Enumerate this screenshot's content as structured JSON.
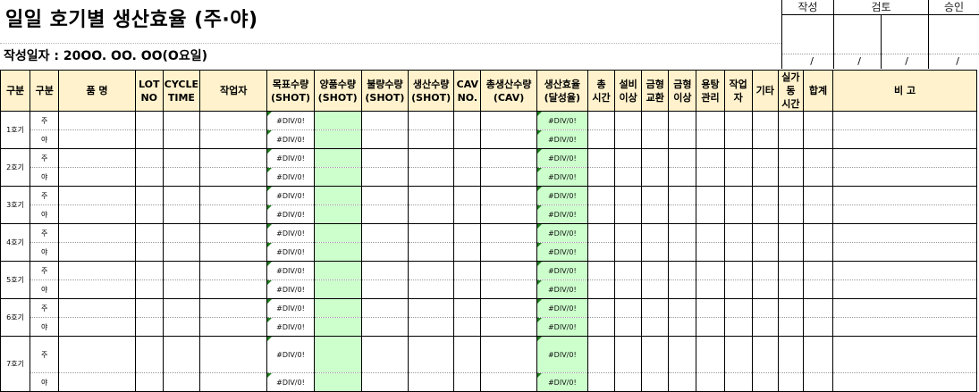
{
  "title": "일일 호기별 생산효율  (주·야)",
  "date_line": "작성일자 : 20OO. OO. OO(O요일)",
  "approval": {
    "headers": [
      "작성",
      "검토",
      "승인"
    ],
    "date_marks": [
      "/",
      "/",
      "/",
      "/"
    ]
  },
  "columns": [
    {
      "lines": [
        "구분"
      ]
    },
    {
      "lines": [
        "구분"
      ]
    },
    {
      "lines": [
        "품     명"
      ]
    },
    {
      "lines": [
        "LOT",
        "NO"
      ]
    },
    {
      "lines": [
        "CYCLE",
        "TIME"
      ]
    },
    {
      "lines": [
        "작업자"
      ]
    },
    {
      "lines": [
        "목표수량",
        "(SHOT)"
      ]
    },
    {
      "lines": [
        "양품수량",
        "(SHOT)"
      ]
    },
    {
      "lines": [
        "불량수량",
        "(SHOT)"
      ]
    },
    {
      "lines": [
        "생산수량",
        "(SHOT)"
      ]
    },
    {
      "lines": [
        "CAV",
        "NO."
      ]
    },
    {
      "lines": [
        "총생산수량",
        "(CAV)"
      ]
    },
    {
      "lines": [
        "생산효율",
        "(달성율)"
      ]
    },
    {
      "lines": [
        "총",
        "시간"
      ]
    },
    {
      "lines": [
        "설비",
        "이상"
      ]
    },
    {
      "lines": [
        "금형",
        "교환"
      ]
    },
    {
      "lines": [
        "금형",
        "이상"
      ]
    },
    {
      "lines": [
        "용탕",
        "관리"
      ]
    },
    {
      "lines": [
        "작업",
        "자"
      ]
    },
    {
      "lines": [
        "기타"
      ]
    },
    {
      "lines": [
        "실가",
        "동",
        "시간"
      ]
    },
    {
      "lines": [
        "합계"
      ]
    },
    {
      "lines": [
        "비          고"
      ]
    }
  ],
  "units": [
    "1호기",
    "2호기",
    "3호기",
    "4호기",
    "5호기",
    "6호기",
    "7호기"
  ],
  "shifts": [
    "주",
    "야"
  ],
  "error_value": "#DIV/0!",
  "colors": {
    "header_bg": "#fff2cc",
    "yield_bg": "#ccffcc",
    "error_marker": "#1e7d1e"
  }
}
